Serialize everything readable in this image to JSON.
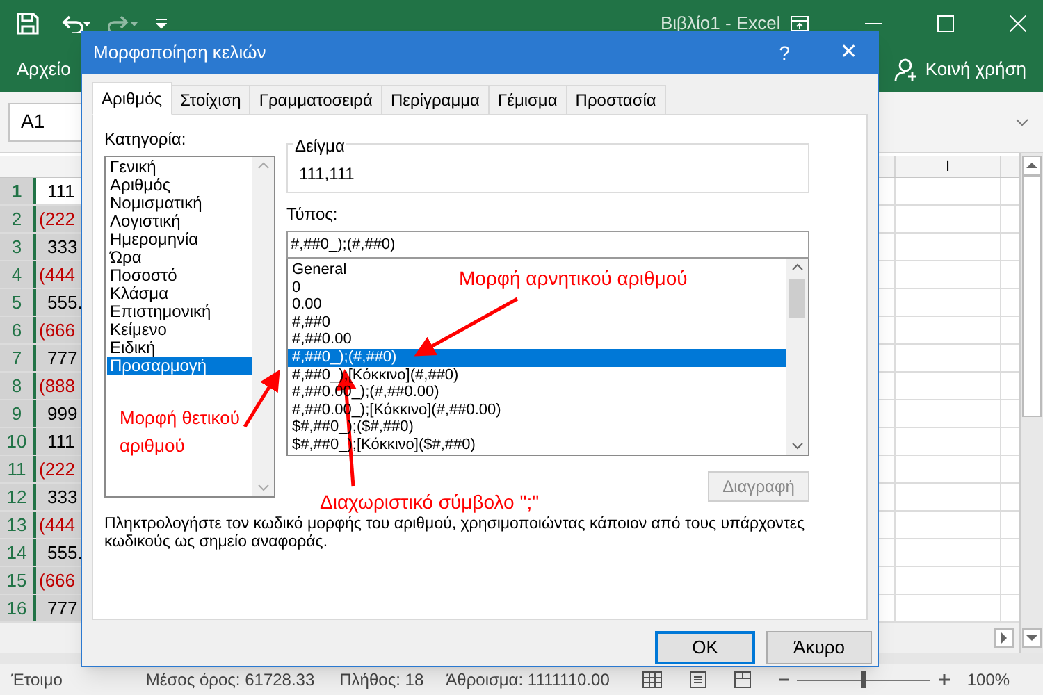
{
  "app": {
    "title": "Βιβλίο1  -  Excel",
    "file_tab": "Αρχείο",
    "share": "Κοινή χρήση",
    "name_box": "A1"
  },
  "sheet": {
    "visible_column": "I",
    "rows": [
      {
        "number": "1",
        "value": "111",
        "negative": false,
        "active": true
      },
      {
        "number": "2",
        "value": "(222",
        "negative": true,
        "active": false
      },
      {
        "number": "3",
        "value": "333",
        "negative": false,
        "active": false
      },
      {
        "number": "4",
        "value": "(444",
        "negative": true,
        "active": false
      },
      {
        "number": "5",
        "value": "555.",
        "negative": false,
        "active": false
      },
      {
        "number": "6",
        "value": "(666",
        "negative": true,
        "active": false
      },
      {
        "number": "7",
        "value": "777",
        "negative": false,
        "active": false
      },
      {
        "number": "8",
        "value": "(888",
        "negative": true,
        "active": false
      },
      {
        "number": "9",
        "value": "999",
        "negative": false,
        "active": false
      },
      {
        "number": "10",
        "value": "111",
        "negative": false,
        "active": false
      },
      {
        "number": "11",
        "value": "(222",
        "negative": true,
        "active": false
      },
      {
        "number": "12",
        "value": "333",
        "negative": false,
        "active": false
      },
      {
        "number": "13",
        "value": "(444",
        "negative": true,
        "active": false
      },
      {
        "number": "14",
        "value": "555.",
        "negative": false,
        "active": false
      },
      {
        "number": "15",
        "value": "(666",
        "negative": true,
        "active": false
      },
      {
        "number": "16",
        "value": "777",
        "negative": false,
        "active": false
      }
    ]
  },
  "status_bar": {
    "state": "Έτοιμο",
    "average": "Μέσος όρος: 61728.33",
    "count": "Πλήθος: 18",
    "sum": "Άθροισμα: 1111110.00",
    "zoom": "100%",
    "zoom_slider": {
      "level": 0.5
    }
  },
  "dialog": {
    "title": "Μορφοποίηση κελιών",
    "help": "?",
    "close": "✕",
    "tabs": [
      {
        "label": "Αριθμός",
        "selected": true
      },
      {
        "label": "Στοίχιση",
        "selected": false
      },
      {
        "label": "Γραμματοσειρά",
        "selected": false
      },
      {
        "label": "Περίγραμμα",
        "selected": false
      },
      {
        "label": "Γέμισμα",
        "selected": false
      },
      {
        "label": "Προστασία",
        "selected": false
      }
    ],
    "category_label": "Κατηγορία:",
    "categories": [
      {
        "label": "Γενική",
        "selected": false
      },
      {
        "label": "Αριθμός",
        "selected": false
      },
      {
        "label": "Νομισματική",
        "selected": false
      },
      {
        "label": "Λογιστική",
        "selected": false
      },
      {
        "label": "Ημερομηνία",
        "selected": false
      },
      {
        "label": "Ώρα",
        "selected": false
      },
      {
        "label": "Ποσοστό",
        "selected": false
      },
      {
        "label": "Κλάσμα",
        "selected": false
      },
      {
        "label": "Επιστημονική",
        "selected": false
      },
      {
        "label": "Κείμενο",
        "selected": false
      },
      {
        "label": "Ειδική",
        "selected": false
      },
      {
        "label": "Προσαρμογή",
        "selected": true
      }
    ],
    "sample_label": "Δείγμα",
    "sample_value": "111,111",
    "type_label": "Τύπος:",
    "type_value": "#,##0_);(#,##0)",
    "formats": [
      {
        "label": "General",
        "selected": false
      },
      {
        "label": "0",
        "selected": false
      },
      {
        "label": "0.00",
        "selected": false
      },
      {
        "label": "#,##0",
        "selected": false
      },
      {
        "label": "#,##0.00",
        "selected": false
      },
      {
        "label": "#,##0_);(#,##0)",
        "selected": true
      },
      {
        "label": "#,##0_);[Κόκκινο](#,##0)",
        "selected": false
      },
      {
        "label": "#,##0.00_);(#,##0.00)",
        "selected": false
      },
      {
        "label": "#,##0.00_);[Κόκκινο](#,##0.00)",
        "selected": false
      },
      {
        "label": "$#,##0_);($#,##0)",
        "selected": false
      },
      {
        "label": "$#,##0_);[Κόκκινο]($#,##0)",
        "selected": false
      }
    ],
    "delete_button": {
      "label": "Διαγραφή",
      "disabled": true
    },
    "description": "Πληκτρολογήστε τον κωδικό μορφής του αριθμού, χρησιμοποιώντας κάποιον από τους υπάρχοντες κωδικούς ως σημείο αναφοράς.",
    "ok": "OK",
    "cancel": "Άκυρο"
  },
  "annotations": [
    {
      "text": "Μορφή αρνητικού αριθμού"
    },
    {
      "text": "Μορφή θετικού αριθμού"
    },
    {
      "text": "Διαχωριστικό σύμβολο \";\""
    }
  ]
}
